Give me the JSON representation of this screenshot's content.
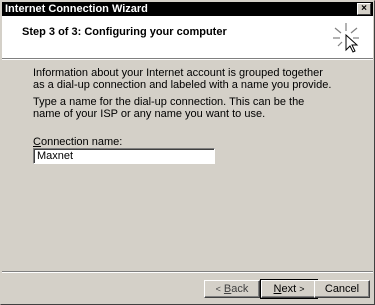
{
  "window": {
    "title": "Internet Connection Wizard",
    "close_glyph": "×"
  },
  "header": {
    "step_title": "Step 3 of 3: Configuring your computer"
  },
  "body": {
    "paragraph_1": "Information about your Internet account is grouped together as a dial-up connection and labeled with a name you provide.",
    "paragraph_2": "Type a name for the dial-up connection. This can be the name of your ISP or any name you want to use.",
    "connection_label_mnemonic": "C",
    "connection_label_rest": "onnection name:",
    "connection_name_value": "Maxnet"
  },
  "buttons": {
    "back_arrow": "<",
    "back_mnemonic": "B",
    "back_rest": "ack",
    "next_mnemonic": "N",
    "next_rest": "ext",
    "next_arrow": ">",
    "cancel": "Cancel"
  },
  "icons": {
    "wizard": "wizard-wand-icon",
    "close": "close-icon"
  },
  "colors": {
    "titlebar": "#000000",
    "face": "#d4d0c8",
    "header_bg": "#ffffff"
  }
}
